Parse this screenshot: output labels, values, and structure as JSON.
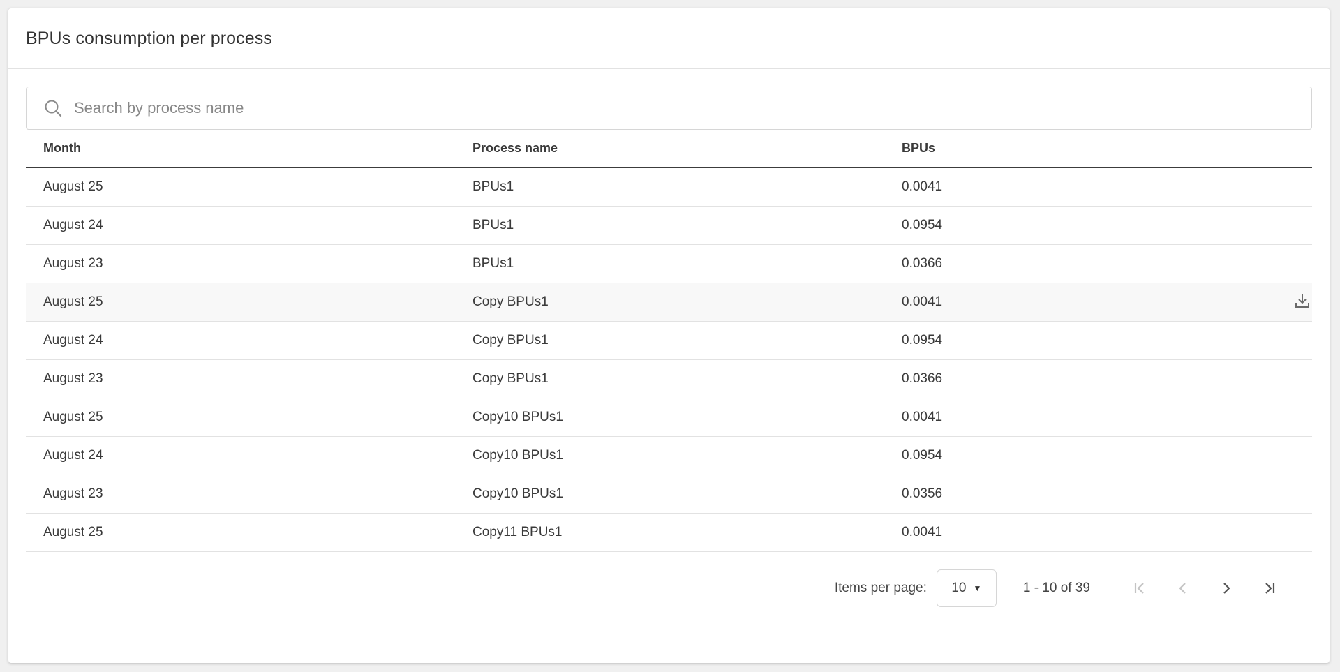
{
  "card": {
    "title": "BPUs consumption per process"
  },
  "search": {
    "placeholder": "Search by process name",
    "value": ""
  },
  "table": {
    "columns": [
      "Month",
      "Process name",
      "BPUs"
    ],
    "rows": [
      {
        "month": "August 25",
        "process": "BPUs1",
        "bpus": "0.0041"
      },
      {
        "month": "August 24",
        "process": "BPUs1",
        "bpus": "0.0954"
      },
      {
        "month": "August 23",
        "process": "BPUs1",
        "bpus": "0.0366"
      },
      {
        "month": "August 25",
        "process": "Copy BPUs1",
        "bpus": "0.0041"
      },
      {
        "month": "August 24",
        "process": "Copy BPUs1",
        "bpus": "0.0954"
      },
      {
        "month": "August 23",
        "process": "Copy BPUs1",
        "bpus": "0.0366"
      },
      {
        "month": "August 25",
        "process": "Copy10 BPUs1",
        "bpus": "0.0041"
      },
      {
        "month": "August 24",
        "process": "Copy10 BPUs1",
        "bpus": "0.0954"
      },
      {
        "month": "August 23",
        "process": "Copy10 BPUs1",
        "bpus": "0.0356"
      },
      {
        "month": "August 25",
        "process": "Copy11 BPUs1",
        "bpus": "0.0041"
      }
    ],
    "hovered_row_index": 3,
    "row_action_icon": "download-icon"
  },
  "paginator": {
    "items_per_page_label": "Items per page:",
    "page_size": "10",
    "range_label": "1 - 10 of 39",
    "icons": [
      "first-page-icon",
      "previous-page-icon",
      "next-page-icon",
      "last-page-icon"
    ]
  },
  "colors": {
    "header_border": "#3c3c3c",
    "row_border": "#e2e2e2",
    "hover_row": "#f8f8f8",
    "disabled_icon": "#c4c4c4",
    "enabled_icon": "#555555"
  }
}
